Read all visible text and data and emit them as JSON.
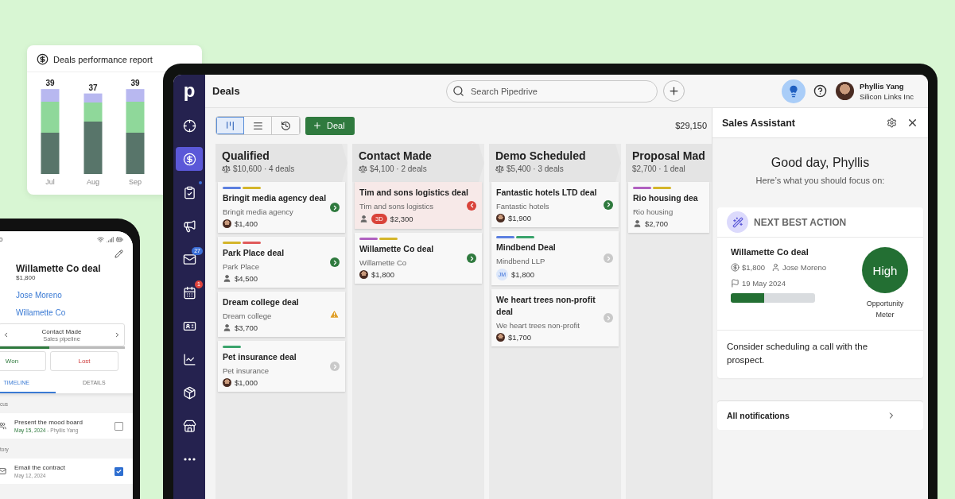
{
  "report": {
    "title": "Deals performance report",
    "chart_data": {
      "type": "bar",
      "categories": [
        "Jul",
        "Aug",
        "Sep"
      ],
      "values": [
        39,
        37,
        39
      ],
      "data_labels": true
    }
  },
  "sidebar": {
    "logo": "p",
    "items": [
      {
        "kind": "target",
        "selected": false,
        "dot": false
      },
      {
        "kind": "deals",
        "selected": true,
        "dot": false
      },
      {
        "kind": "tasks",
        "selected": false,
        "dot": true
      },
      {
        "kind": "campaigns",
        "selected": false,
        "dot": false
      },
      {
        "kind": "mail",
        "selected": false,
        "dot": false,
        "badge": "27",
        "color": "#3b6fd8"
      },
      {
        "kind": "calendar",
        "selected": false,
        "dot": false,
        "badge": "1",
        "color": "#e0433b"
      },
      {
        "kind": "contacts",
        "selected": false,
        "dot": false
      },
      {
        "kind": "insights",
        "selected": false,
        "dot": false
      },
      {
        "kind": "products",
        "selected": false,
        "dot": false
      },
      {
        "kind": "marketplace",
        "selected": false,
        "dot": false
      },
      {
        "kind": "more",
        "selected": false,
        "dot": false
      }
    ]
  },
  "header": {
    "title": "Deals",
    "search": {
      "placeholder": "Search Pipedrive"
    },
    "assistant_button": {
      "selected": true
    },
    "user": {
      "name": "Phyllis Yang",
      "company": "Silicon Links Inc"
    }
  },
  "toolbar": {
    "views": [
      {
        "kind": "pipeline",
        "selected": true
      },
      {
        "kind": "list",
        "selected": false
      },
      {
        "kind": "forecast",
        "selected": false
      }
    ],
    "add_button": "Deal",
    "total": "$29,150"
  },
  "columns": [
    {
      "title": "Qualified",
      "summary": "$10,600 · 4 deals",
      "deals": [
        {
          "title": "Bringit media agency deal",
          "org": "Bringit media agency",
          "value": "$1,400",
          "labels": [
            {
              "color": "#5b7fe0"
            },
            {
              "color": "#d4b52a"
            }
          ],
          "owner": {
            "kind": "photo"
          },
          "action": {
            "kind": "forward"
          },
          "highlighted": false
        },
        {
          "title": "Park Place deal",
          "org": "Park Place",
          "value": "$4,500",
          "labels": [
            {
              "color": "#d4b52a"
            },
            {
              "color": "#e05a5a"
            }
          ],
          "owner": {
            "kind": "person"
          },
          "action": {
            "kind": "forward"
          },
          "highlighted": false
        },
        {
          "title": "Dream college deal",
          "org": "Dream college",
          "value": "$3,700",
          "owner": {
            "kind": "person"
          },
          "action": {
            "kind": "warning"
          },
          "highlighted": false
        },
        {
          "title": "Pet insurance deal",
          "org": "Pet insurance",
          "value": "$1,000",
          "labels": [
            {
              "color": "#3aa36b"
            }
          ],
          "owner": {
            "kind": "photo"
          },
          "action": {
            "kind": "idle"
          },
          "highlighted": false
        }
      ]
    },
    {
      "title": "Contact Made",
      "summary": "$4,100 · 2 deals",
      "deals": [
        {
          "title": "Tim and sons logistics deal",
          "org": "Tim and sons logistics",
          "value": "$2,300",
          "overdue": "3D",
          "owner": {
            "kind": "person"
          },
          "action": {
            "kind": "back"
          },
          "highlighted": true
        },
        {
          "title": "Willamette Co deal",
          "org": "Willamette Co",
          "value": "$1,800",
          "labels": [
            {
              "color": "#b060c0"
            },
            {
              "color": "#d4b52a"
            }
          ],
          "owner": {
            "kind": "photo"
          },
          "action": {
            "kind": "forward"
          },
          "highlighted": false
        }
      ]
    },
    {
      "title": "Demo Scheduled",
      "summary": "$5,400 · 3 deals",
      "deals": [
        {
          "title": "Fantastic hotels LTD deal",
          "org": "Fantastic hotels",
          "value": "$1,900",
          "owner": {
            "kind": "photo"
          },
          "action": {
            "kind": "forward"
          },
          "highlighted": false
        },
        {
          "title": "Mindbend Deal",
          "org": "Mindbend LLP",
          "value": "$1,800",
          "labels": [
            {
              "color": "#5b7fe0"
            },
            {
              "color": "#3aa36b"
            }
          ],
          "owner": {
            "kind": "initials",
            "initials": "JM"
          },
          "action": {
            "kind": "idle"
          },
          "highlighted": false
        },
        {
          "title": "We heart trees non-profit deal",
          "org": "We heart trees non-profit",
          "value": "$1,700",
          "owner": {
            "kind": "photo"
          },
          "action": {
            "kind": "idle"
          },
          "highlighted": false
        }
      ]
    },
    {
      "title": "Proposal Mad",
      "summary": "$2,700 · 1 deal",
      "deals": [
        {
          "title": "Rio housing dea",
          "org": "Rio housing",
          "value": "$2,700",
          "labels": [
            {
              "color": "#b060c0"
            },
            {
              "color": "#d4b52a"
            }
          ],
          "owner": {
            "kind": "person"
          },
          "highlighted": false
        }
      ]
    }
  ],
  "assistant": {
    "title": "Sales Assistant",
    "greeting": "Good day, Phyllis",
    "subtitle": "Here’s what you should focus on:",
    "card": {
      "heading": "NEXT BEST ACTION",
      "deal": "Willamette Co deal",
      "value": "$1,800",
      "person": "Jose Moreno",
      "date": "19 May 2024",
      "level": 0.4,
      "rating": "High",
      "meter_label": "Opportunity Meter",
      "suggestion": "Consider scheduling a call with the prospect."
    },
    "notifications": "All notifications"
  },
  "phone": {
    "time": "0",
    "deal": "Willamette Co deal",
    "value": "$1,800",
    "contact": "Jose Moreno",
    "org": "Willamette Co",
    "stage": "Contact Made",
    "pipeline": "Sales pipeline",
    "level": 0.4,
    "won": "Won",
    "lost": "Lost",
    "tabs": [
      {
        "label": "TIMELINE",
        "selected": true
      },
      {
        "label": "DETAILS",
        "selected": false
      }
    ],
    "sections": [
      {
        "title": "cus",
        "items": [
          {
            "kind": "meeting",
            "title": "Present the mood board",
            "date": "May 15, 2024",
            "by": " - Phyllis Yang",
            "checked": false
          }
        ]
      },
      {
        "title": "tory",
        "items": [
          {
            "kind": "email",
            "title": "Email the contract",
            "date": "May 12, 2024",
            "checked": true
          }
        ]
      }
    ]
  }
}
